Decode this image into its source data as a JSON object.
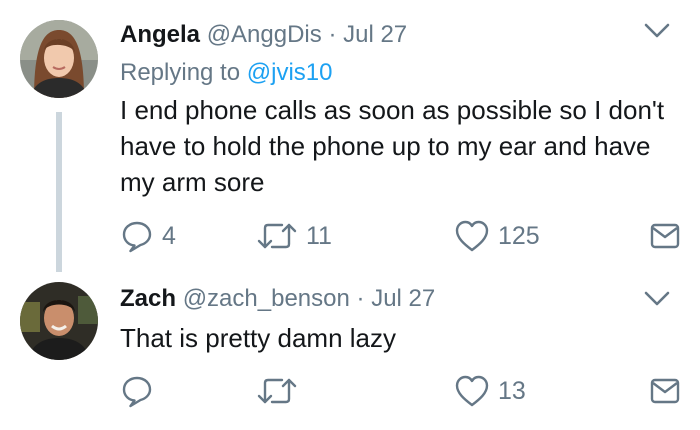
{
  "tweets": [
    {
      "name": "Angela",
      "handle": "@AnggDis",
      "separator": "·",
      "date": "Jul 27",
      "replying_prefix": "Replying to",
      "replying_to": "@jvis10",
      "text": "I end phone calls as soon as possible so I don't have to hold the phone up to my ear and have my arm sore",
      "replies": "4",
      "retweets": "11",
      "likes": "125"
    },
    {
      "name": "Zach",
      "handle": "@zach_benson",
      "separator": "·",
      "date": "Jul 27",
      "text": "That is pretty damn lazy",
      "replies": "",
      "retweets": "",
      "likes": "13"
    }
  ],
  "colors": {
    "text": "#14171a",
    "secondary": "#657786",
    "link": "#1da1f2",
    "thread_line": "#ccd6dd"
  },
  "icons": [
    "chevron-down-icon",
    "reply-icon",
    "retweet-icon",
    "like-icon",
    "direct-message-icon"
  ]
}
